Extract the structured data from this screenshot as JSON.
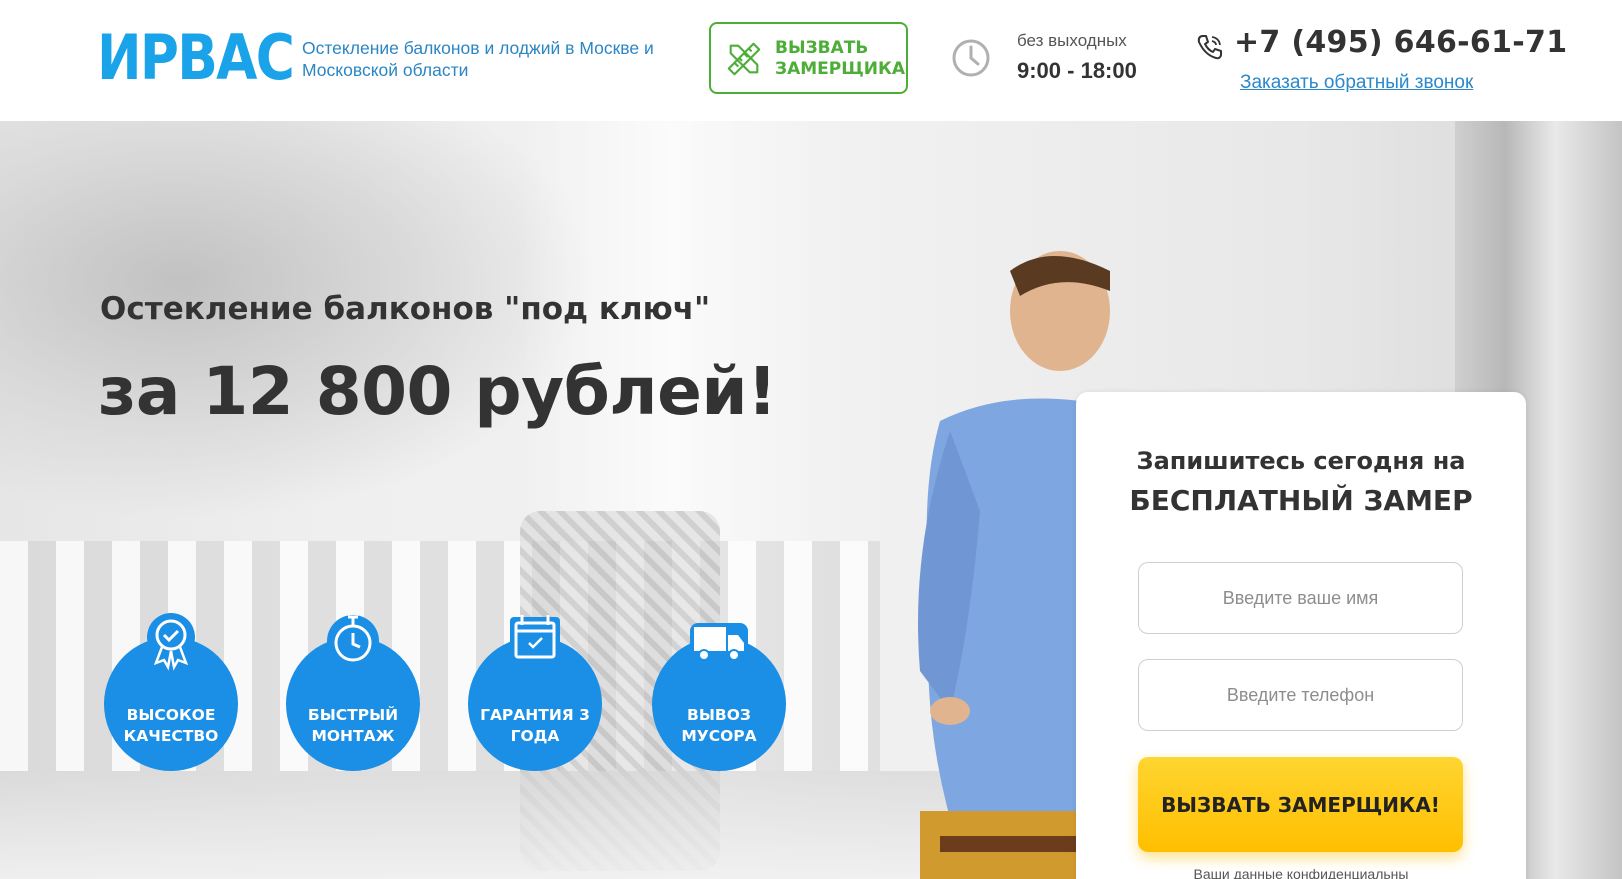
{
  "header": {
    "logo": "ИРВАС",
    "tagline": "Остекление балконов и лоджий в Москве и Московской области",
    "call_button": "ВЫЗВАТЬ ЗАМЕРЩИКА",
    "hours_label": "без выходных",
    "hours": "9:00 - 18:00",
    "phone": "+7 (495) 646-61-71",
    "callback_link": "Заказать обратный звонок"
  },
  "hero": {
    "subtitle": "Остекление балконов \"под ключ\"",
    "title": "за 12 800 рублей!",
    "badges": [
      {
        "label": "ВЫСОКОЕ КАЧЕСТВО",
        "icon": "quality-award-icon"
      },
      {
        "label": "БЫСТРЫЙ МОНТАЖ",
        "icon": "stopwatch-icon"
      },
      {
        "label": "ГАРАНТИЯ 3 ГОДА",
        "icon": "calendar-certificate-icon"
      },
      {
        "label": "ВЫВОЗ МУСОРА",
        "icon": "truck-icon"
      }
    ]
  },
  "form": {
    "title_line1": "Запишитесь сегодня на",
    "title_line2": "БЕСПЛАТНЫЙ ЗАМЕР",
    "name_placeholder": "Введите ваше имя",
    "phone_placeholder": "Введите телефон",
    "submit": "ВЫЗВАТЬ ЗАМЕРЩИКА!",
    "privacy": "Ваши данные конфиденциальны"
  },
  "colors": {
    "brand_blue": "#1b8ee6",
    "accent_green": "#4cae37",
    "cta_yellow": "#ffc600"
  }
}
